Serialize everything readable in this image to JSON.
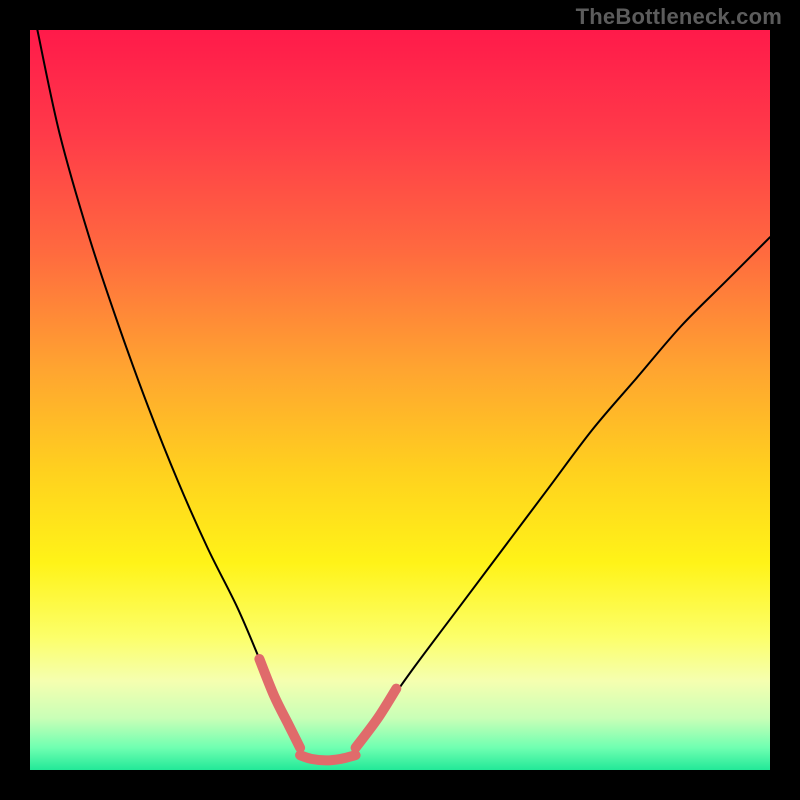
{
  "watermark": "TheBottleneck.com",
  "chart_data": {
    "type": "line",
    "title": "",
    "xlabel": "",
    "ylabel": "",
    "xlim": [
      0,
      100
    ],
    "ylim": [
      0,
      100
    ],
    "grid": false,
    "background_gradient": {
      "stops": [
        {
          "offset": 0.0,
          "color": "#ff1a4a"
        },
        {
          "offset": 0.14,
          "color": "#ff3a49"
        },
        {
          "offset": 0.3,
          "color": "#ff6a3f"
        },
        {
          "offset": 0.46,
          "color": "#ffa530"
        },
        {
          "offset": 0.6,
          "color": "#ffd21e"
        },
        {
          "offset": 0.72,
          "color": "#fff318"
        },
        {
          "offset": 0.82,
          "color": "#fcff69"
        },
        {
          "offset": 0.88,
          "color": "#f5ffb0"
        },
        {
          "offset": 0.93,
          "color": "#c9ffb7"
        },
        {
          "offset": 0.97,
          "color": "#6fffb1"
        },
        {
          "offset": 1.0,
          "color": "#22e998"
        }
      ]
    },
    "series": [
      {
        "name": "left-descending-curve",
        "color": "#000000",
        "width": 2,
        "x": [
          1,
          4,
          8,
          12,
          16,
          20,
          24,
          28,
          31,
          33,
          35,
          36.5
        ],
        "y": [
          100,
          86,
          72,
          60,
          49,
          39,
          30,
          22,
          15,
          10,
          6,
          3
        ]
      },
      {
        "name": "right-ascending-curve",
        "color": "#000000",
        "width": 2,
        "x": [
          44,
          47,
          52,
          58,
          64,
          70,
          76,
          82,
          88,
          94,
          100
        ],
        "y": [
          3,
          7,
          14,
          22,
          30,
          38,
          46,
          53,
          60,
          66,
          72
        ]
      },
      {
        "name": "highlight-segments",
        "color": "#e06b6b",
        "width": 10,
        "linecap": "round",
        "segments": [
          {
            "x": [
              31,
              33,
              35,
              36.5
            ],
            "y": [
              15,
              10,
              6,
              3
            ]
          },
          {
            "x": [
              36.5,
              38,
              40,
              42,
              44
            ],
            "y": [
              2,
              1.5,
              1.3,
              1.5,
              2
            ]
          },
          {
            "x": [
              44,
              47,
              49.5
            ],
            "y": [
              3,
              7,
              11
            ]
          }
        ]
      }
    ],
    "annotations": []
  }
}
